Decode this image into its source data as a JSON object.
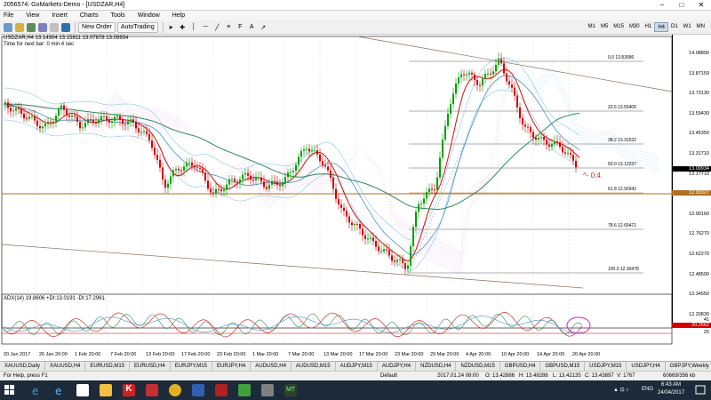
{
  "window": {
    "title": "2056574: GoMarkets-Demo - [USDZAR,H4]"
  },
  "menu": [
    "File",
    "View",
    "Insert",
    "Charts",
    "Tools",
    "Window",
    "Help"
  ],
  "toolbar": {
    "new_order": "New Order",
    "autotrading": "AutoTrading",
    "timeframes": [
      "M1",
      "M5",
      "M15",
      "M30",
      "H1",
      "H4",
      "D1",
      "W1",
      "MN"
    ],
    "active_timeframe": "H4"
  },
  "chart": {
    "header": "USDZAR,H4  13.14304 13.15811 13.07878 13.09934",
    "timer": "Time for next bar: 0 min 4 sec",
    "annotation": "^- 0:4",
    "price_ticks": [
      "14.08890",
      "13.87159",
      "13.73130",
      "13.59430",
      "13.45350",
      "13.31710",
      "13.17710",
      "13.03990",
      "12.90160",
      "12.76270",
      "12.62270",
      "12.48590",
      "12.34550",
      "12.20830"
    ],
    "current_price": "13.09934",
    "line_price": "12.93327",
    "time_ticks": [
      "20 Jan 2017",
      "26 Jan 20:00",
      "1 Feb 20:00",
      "7 Feb 20:00",
      "13 Feb 20:00",
      "17 Feb 20:00",
      "23 Feb 20:00",
      "1 Mar 20:00",
      "7 Mar 20:00",
      "13 Mar 20:00",
      "17 Mar 20:00",
      "23 Mar 20:00",
      "29 Mar 20:00",
      "4 Apr 20:00",
      "10 Apr 20:00",
      "14 Apr 20:00",
      "20 Apr 20:00"
    ],
    "fib_levels": [
      {
        "label": "0.0  13.83996"
      },
      {
        "label": "23.6  13.55406"
      },
      {
        "label": "38.2  13.31532"
      },
      {
        "label": "50.0  13.12237"
      },
      {
        "label": "61.8  12.92942"
      },
      {
        "label": "78.6  12.65471"
      },
      {
        "label": "100.0  12.30478"
      }
    ],
    "adx_header": "ADX(14) 19.8606 +DI:13.0191 -DI:17.2961",
    "adx_ticks": [
      "41",
      "20",
      "0"
    ],
    "adx_value": "20.2562"
  },
  "tabs": [
    "XAUUSD,Daily",
    "XAUUSD,H4",
    "EURUSD,M15",
    "EURUSD,H4",
    "EURJPY,M15",
    "EURJPY,H4",
    "AUDUSD,H4",
    "AUDUSD,M15",
    "AUDJPY,M15",
    "AUDJPY,H4",
    "NZDUSD,H4",
    "NZDUSD,M15",
    "GBPUSD,H4",
    "GBPUSD,M15",
    "USDJPY,M15",
    "USDJPY,H4",
    "GBPJPY,Weekly"
  ],
  "active_tab": "USDZAR,H4",
  "status": {
    "help": "For Help, press F1",
    "profile": "Default",
    "datetime": "2017.01.24 08:00",
    "open": "O: 13.42886",
    "high": "H: 13.48286",
    "low": "L: 13.42135",
    "close": "C: 13.43897",
    "volume": "V: 1767",
    "traffic": "60669/356 kb"
  },
  "taskbar": {
    "time": "6:43 AM",
    "date": "24/04/2017",
    "lang": "ENG"
  },
  "colors": {
    "candle_up": "#00a000",
    "candle_down": "#d00000",
    "ma_green": "#2e8b57",
    "ma_blue": "#4a90c8",
    "cloud": "#e8a8e8",
    "hline": "#b07020"
  }
}
